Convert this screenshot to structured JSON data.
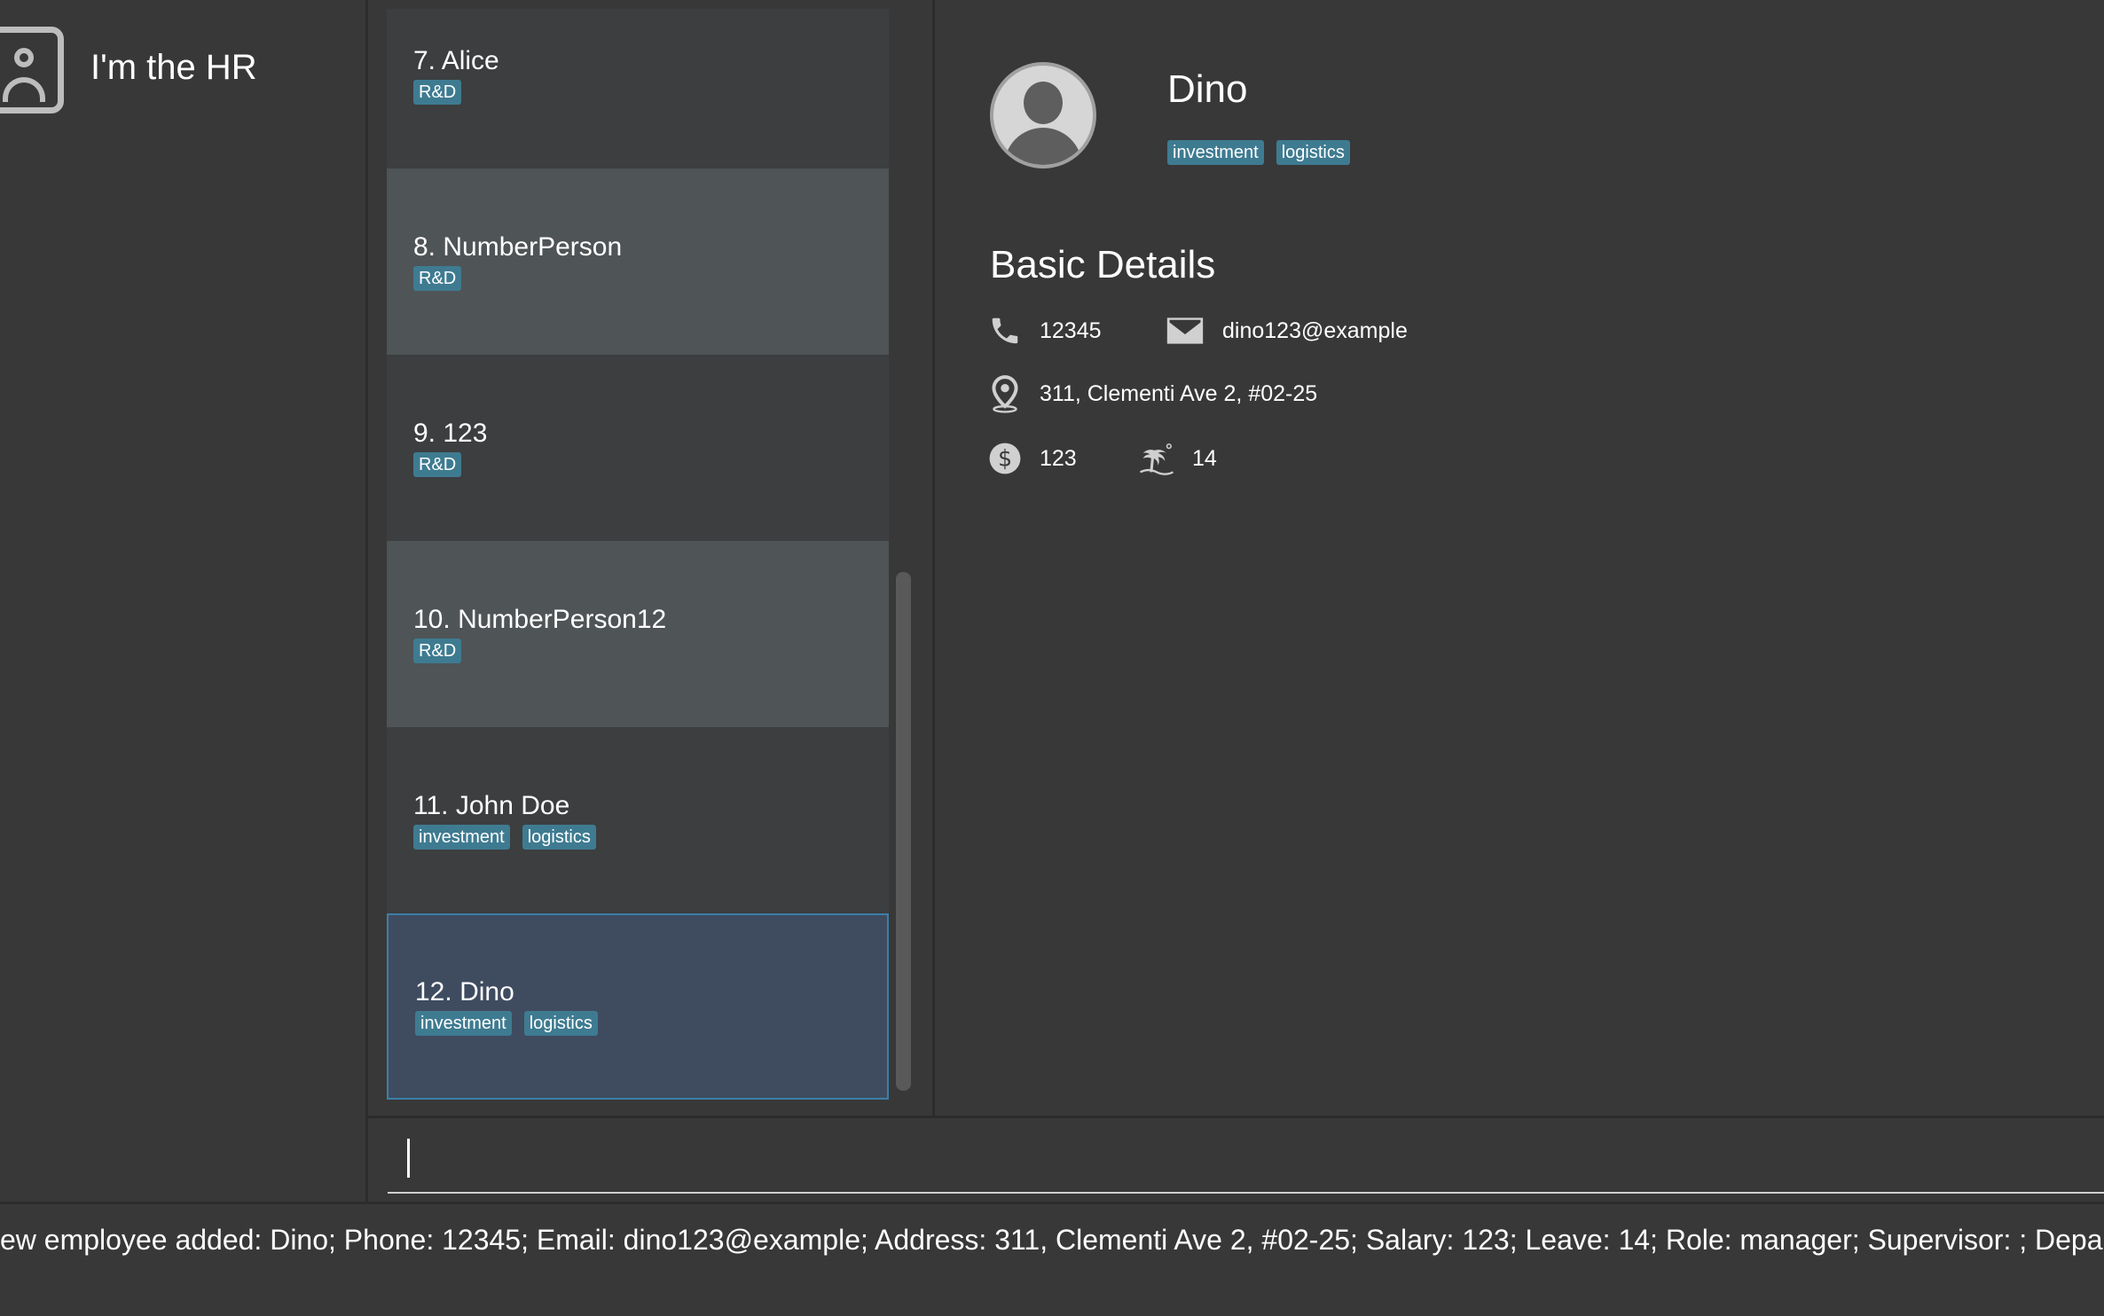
{
  "app": {
    "title": "I'm the HR",
    "icon": "person-badge-icon"
  },
  "list": {
    "items": [
      {
        "index": "7.",
        "name": "Alice",
        "tags": [
          "R&D"
        ]
      },
      {
        "index": "8.",
        "name": "NumberPerson",
        "tags": [
          "R&D"
        ]
      },
      {
        "index": "9.",
        "name": "123",
        "tags": [
          "R&D"
        ]
      },
      {
        "index": "10.",
        "name": "NumberPerson12",
        "tags": [
          "R&D"
        ]
      },
      {
        "index": "11.",
        "name": "John Doe",
        "tags": [
          "investment",
          "logistics"
        ]
      },
      {
        "index": "12.",
        "name": "Dino",
        "tags": [
          "investment",
          "logistics"
        ]
      }
    ]
  },
  "detail": {
    "name": "Dino",
    "tags": [
      "investment",
      "logistics"
    ],
    "section_title": "Basic Details",
    "phone": "12345",
    "email": "dino123@example",
    "address": "311, Clementi Ave 2, #02-25",
    "salary": "123",
    "leave": "14"
  },
  "command": {
    "value": ""
  },
  "result": {
    "text": "ew employee added: Dino; Phone: 12345; Email: dino123@example; Address: 311, Clementi Ave 2, #02-25; Salary: 123; Leave: 14; Role: manager; Supervisor: ; Depar"
  },
  "colors": {
    "background": "#383838",
    "tag": "#3e7b91",
    "selected_border": "#3b7fa8"
  }
}
